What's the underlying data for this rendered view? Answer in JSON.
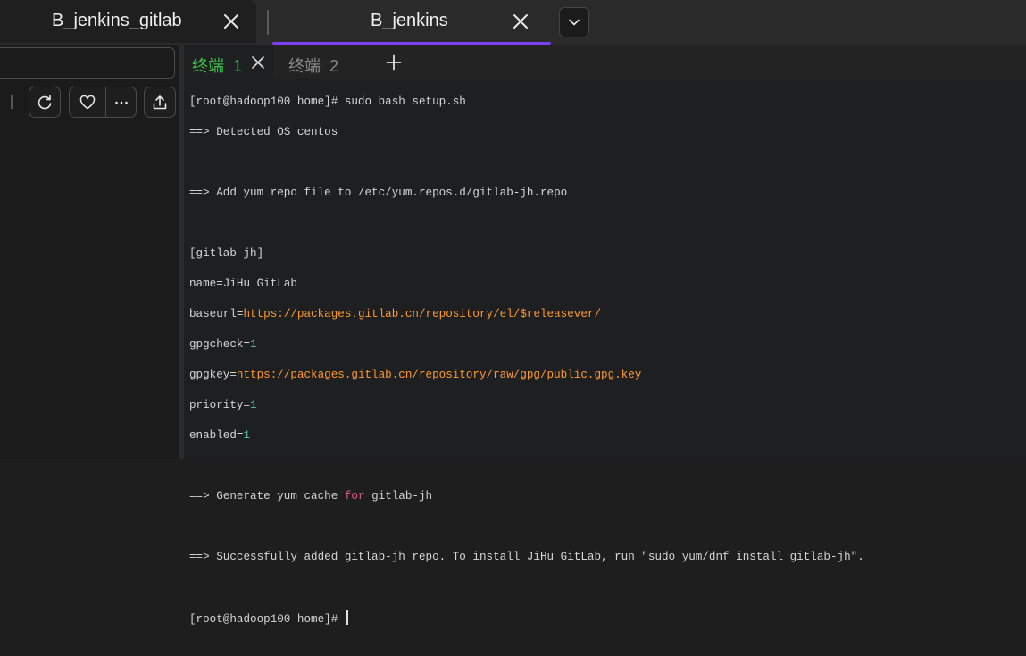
{
  "window_tabs": [
    {
      "title": "B_jenkins_gitlab",
      "active": false
    },
    {
      "title": "B_jenkins",
      "active": true
    }
  ],
  "accent_color": "#7b3ff2",
  "toolbar_icons": [
    "refresh-icon",
    "heart-icon",
    "more-icon",
    "share-icon"
  ],
  "terminal": {
    "tabs": [
      {
        "label": "终端",
        "index": "1",
        "active": true
      },
      {
        "label": "终端",
        "index": "2",
        "active": false
      }
    ],
    "lines": {
      "l1": "[root@hadoop100 home]# sudo bash setup.sh",
      "l2": "==> Detected OS centos",
      "l3": "==> Add yum repo file to /etc/yum.repos.d/gitlab-jh.repo",
      "l4": "[gitlab-jh]",
      "l5": "name=JiHu GitLab",
      "l6_key": "baseurl=",
      "l6_val": "https://packages.gitlab.cn/repository/el/$releasever/",
      "l7_key": "gpgcheck=",
      "l7_val": "1",
      "l8_key": "gpgkey=",
      "l8_val": "https://packages.gitlab.cn/repository/raw/gpg/public.gpg.key",
      "l9_key": "priority=",
      "l9_val": "1",
      "l10_key": "enabled=",
      "l10_val": "1",
      "l11_a": "==> Generate yum cache ",
      "l11_kw": "for",
      "l11_b": " gitlab-jh",
      "l12": "==> Successfully added gitlab-jh repo. To install JiHu GitLab, run \"sudo yum/dnf install gitlab-jh\".",
      "prompt": "[root@hadoop100 home]# "
    }
  }
}
